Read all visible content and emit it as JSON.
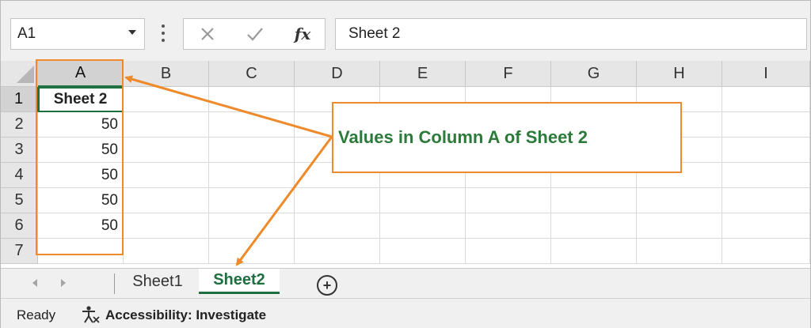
{
  "formula_bar": {
    "name_box": "A1",
    "formula": "Sheet 2",
    "fx_label": "fx"
  },
  "columns": [
    "A",
    "B",
    "C",
    "D",
    "E",
    "F",
    "G",
    "H",
    "I"
  ],
  "rows": [
    "1",
    "2",
    "3",
    "4",
    "5",
    "6",
    "7"
  ],
  "cells": {
    "a1": "Sheet 2",
    "a2": "50",
    "a3": "50",
    "a4": "50",
    "a5": "50",
    "a6": "50"
  },
  "tabs": [
    {
      "label": "Sheet1"
    },
    {
      "label": "Sheet2",
      "active": true
    }
  ],
  "status": {
    "ready": "Ready",
    "accessibility": "Accessibility: Investigate"
  },
  "annotation": {
    "text": "Values in Column A of Sheet 2",
    "border_color": "#ef8a2a",
    "text_color": "#2b7a3a"
  },
  "theme": {
    "selection_green": "#1e6e40"
  }
}
